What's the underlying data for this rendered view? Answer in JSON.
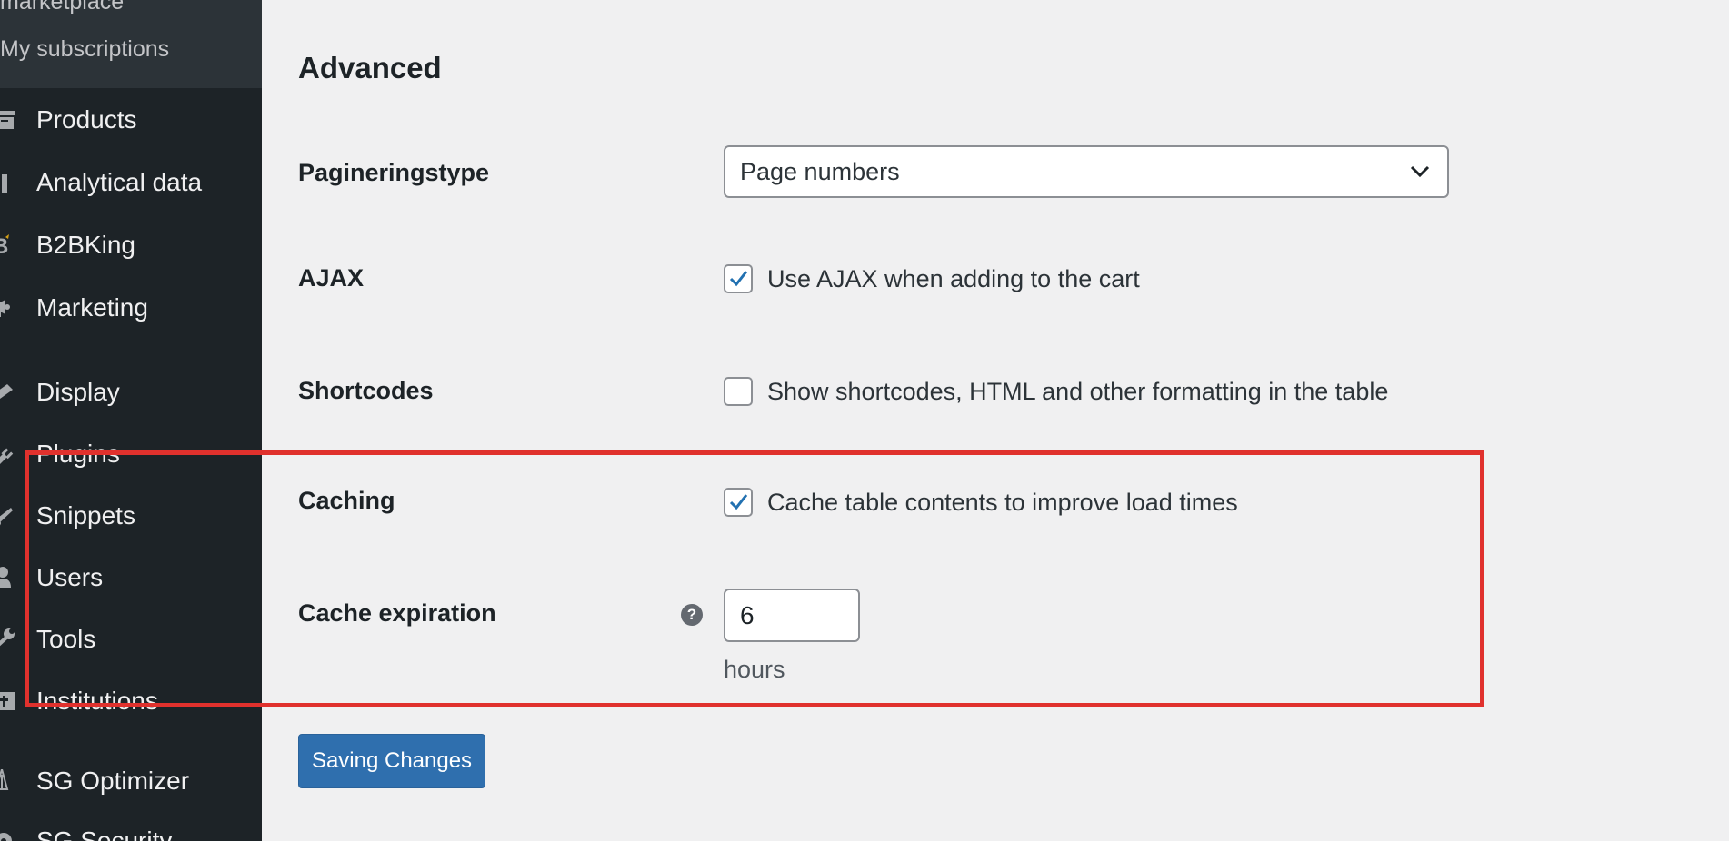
{
  "sidebar": {
    "submenu": [
      "marketplace",
      "My subscriptions"
    ],
    "items": [
      {
        "label": "Products",
        "icon": "archive-icon"
      },
      {
        "label": "Analytical data",
        "icon": "bar-chart-icon"
      },
      {
        "label": "B2BKing",
        "icon": "b2bking-icon"
      },
      {
        "label": "Marketing",
        "icon": "megaphone-icon"
      },
      {
        "label": "Display",
        "icon": "paintbrush-icon"
      },
      {
        "label": "Plugins",
        "icon": "plug-icon"
      },
      {
        "label": "Snippets",
        "icon": "scissors-icon"
      },
      {
        "label": "Users",
        "icon": "user-icon"
      },
      {
        "label": "Tools",
        "icon": "wrench-icon"
      },
      {
        "label": "Institutions",
        "icon": "settings-icon"
      },
      {
        "label": "SG Optimizer",
        "icon": "rocket-icon"
      },
      {
        "label": "SG Security",
        "icon": "gear-icon"
      }
    ]
  },
  "main": {
    "title": "Advanced",
    "pagination": {
      "label": "Pagineringstype",
      "value": "Page numbers"
    },
    "ajax": {
      "label": "AJAX",
      "option": "Use AJAX when adding to the cart",
      "checked": true
    },
    "shortcodes": {
      "label": "Shortcodes",
      "option": "Show shortcodes, HTML and other formatting in the table",
      "checked": false
    },
    "caching": {
      "label": "Caching",
      "option": "Cache table contents to improve load times",
      "checked": true
    },
    "cache_expiration": {
      "label": "Cache expiration",
      "help": "?",
      "value": "6",
      "unit": "hours"
    },
    "save_label": "Saving Changes"
  },
  "colors": {
    "sidebar_bg": "#1d2327",
    "submenu_bg": "#2c3338",
    "accent": "#2271b1",
    "button": "#2f6fae",
    "highlight": "#e0312d"
  }
}
